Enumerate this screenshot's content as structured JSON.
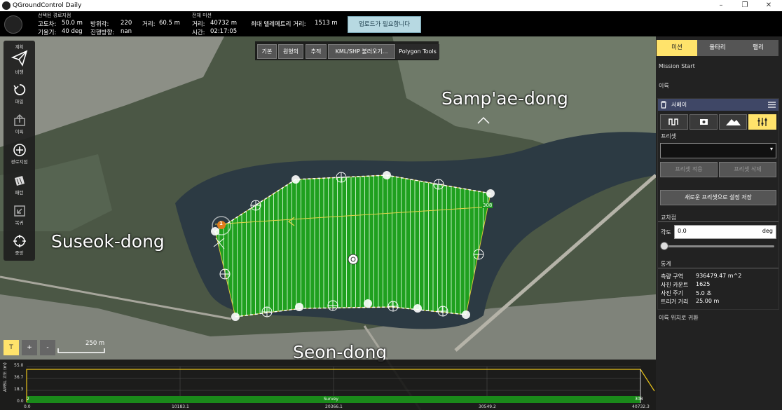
{
  "window": {
    "title": "QGroundControl Daily",
    "minimize": "–",
    "maximize": "❐",
    "close": "✕"
  },
  "topbar": {
    "selected_waypoint_label": "선택된 경로지점",
    "alt_diff_label": "고도차:",
    "alt_diff_value": "50.0 m",
    "gradient_label": "기울기:",
    "gradient_value": "40 deg",
    "azimuth_label": "방위각:",
    "azimuth_value": "220",
    "heading_label": "진행방향:",
    "heading_value": "nan",
    "distance_label": "거리:",
    "distance_value": "60.5 m",
    "total_mission_label": "전체 미션",
    "total_distance_label": "거리:",
    "total_distance_value": "40732 m",
    "time_label": "시간:",
    "time_value": "02:17:05",
    "max_telem_label": "최대 텔레메트리 거리:",
    "max_telem_value": "1513 m",
    "upload_button": "업로드가 필요합니다"
  },
  "left_toolbar": {
    "items": [
      {
        "label": "계획",
        "icon": "plan-label"
      },
      {
        "label": "비행",
        "icon": "paper-plane-icon"
      },
      {
        "label": "파일",
        "icon": "sync-icon"
      },
      {
        "label": "이륙",
        "icon": "takeoff-icon"
      },
      {
        "label": "경로지점",
        "icon": "plus-circle-icon"
      },
      {
        "label": "패턴",
        "icon": "pattern-icon"
      },
      {
        "label": "복귀",
        "icon": "return-icon"
      },
      {
        "label": "중앙",
        "icon": "crosshair-icon"
      }
    ]
  },
  "plan_toolbar": {
    "basic": "기본",
    "circular": "원형의",
    "trace": "추적",
    "kml": "KML/SHP 불러오기...",
    "polygon_tools": "Polygon Tools"
  },
  "map": {
    "labels": [
      "Samp'ae-dong",
      "Suseok-dong",
      "Seon-dong"
    ],
    "start_marker": "1",
    "end_label": "308",
    "scale_text": "250 m",
    "zoom": {
      "t": "T",
      "plus": "+",
      "minus": "-"
    }
  },
  "profile": {
    "y_ticks": [
      "55.0",
      "36.7",
      "18.3",
      "0.0"
    ],
    "x_ticks": [
      "0.0",
      "10183.1",
      "20366.1",
      "30549.2",
      "40732.3"
    ],
    "y_axis_label": "AMSL 고도 (m)",
    "start_label": "2",
    "end_label": "308",
    "survey_label": "Survey"
  },
  "right_panel": {
    "tabs": [
      "미션",
      "울타리",
      "랠리"
    ],
    "mission_start": "Mission Start",
    "takeoff": "이륙",
    "survey_title": "서베이",
    "preset_label": "프리셋",
    "preset_value": "",
    "apply_preset": "프리셋 적용",
    "delete_preset": "프리셋 삭제",
    "save_new_preset": "새로운 프리셋으로 설정 저장",
    "transects_label": "교차점",
    "angle_label": "각도",
    "angle_value": "0.0",
    "angle_unit": "deg",
    "stats_label": "통계",
    "stats": [
      {
        "label": "측량 구역",
        "value": "936479.47 m^2"
      },
      {
        "label": "사진 카운트",
        "value": "1625"
      },
      {
        "label": "사진 주기",
        "value": "5.0 초"
      },
      {
        "label": "트리거 거리",
        "value": "25.00 m"
      }
    ],
    "return_label": "이륙 위치로 귀환"
  },
  "colors": {
    "accent": "#ffe36b",
    "survey_fill": "#1fa01f",
    "panel_bg": "#222222",
    "header_blue": "#3f4766"
  }
}
